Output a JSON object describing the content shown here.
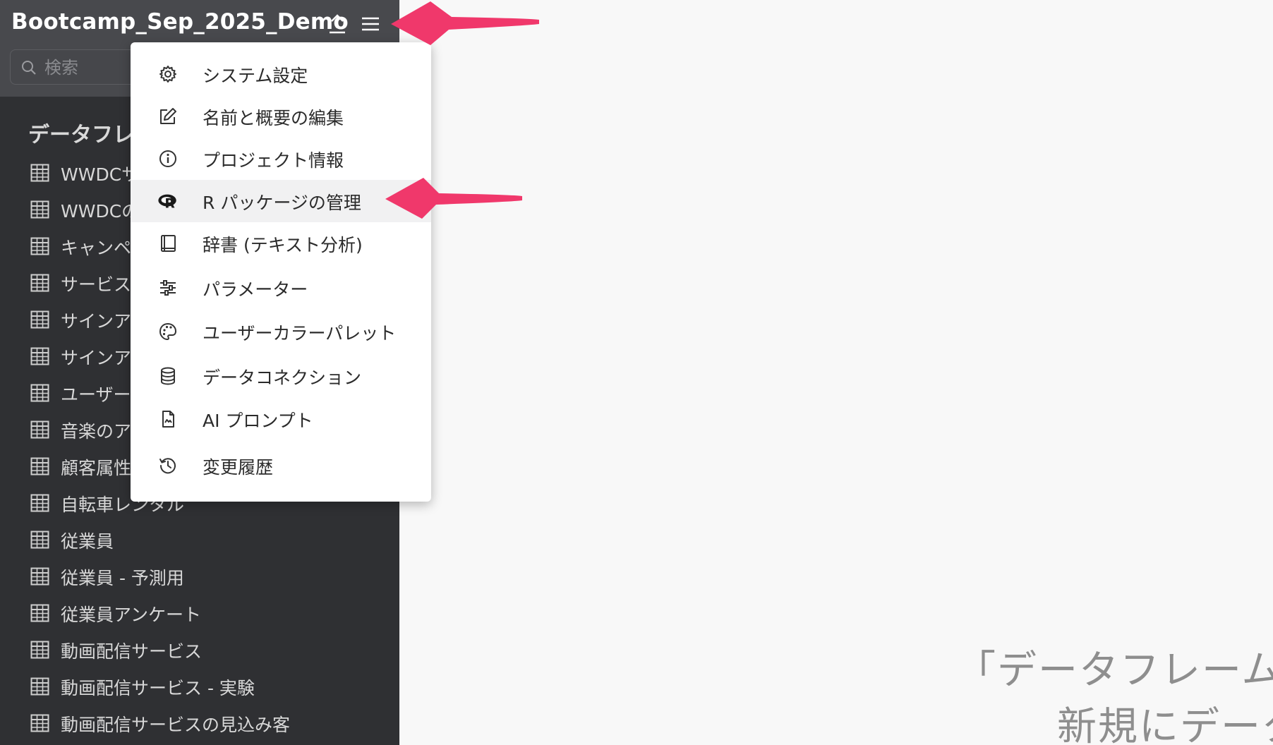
{
  "project": {
    "title": "Bootcamp_Sep_2025_Demo"
  },
  "search": {
    "placeholder": "検索"
  },
  "sidebar": {
    "section_header": "データフレ",
    "items": [
      {
        "label": "WWDCサ"
      },
      {
        "label": "WWDCの"
      },
      {
        "label": "キャンペ"
      },
      {
        "label": "サービス"
      },
      {
        "label": "サインア"
      },
      {
        "label": "サインア"
      },
      {
        "label": "ユーザー"
      },
      {
        "label": "音楽のア"
      },
      {
        "label": "顧客属性"
      },
      {
        "label": "自転車レンタル"
      },
      {
        "label": "従業員"
      },
      {
        "label": "従業員 - 予測用"
      },
      {
        "label": "従業員アンケート"
      },
      {
        "label": "動画配信サービス"
      },
      {
        "label": "動画配信サービス - 実験"
      },
      {
        "label": "動画配信サービスの見込み客"
      }
    ]
  },
  "menu": {
    "items": [
      {
        "label": "システム設定",
        "icon": "gear-icon"
      },
      {
        "label": "名前と概要の編集",
        "icon": "edit-icon"
      },
      {
        "label": "プロジェクト情報",
        "icon": "info-icon"
      },
      {
        "label": "R パッケージの管理",
        "icon": "r-logo-icon",
        "highlighted": true
      },
      {
        "label": "辞書 (テキスト分析)",
        "icon": "book-icon"
      },
      {
        "label": "パラメーター",
        "icon": "sliders-icon"
      },
      {
        "label": "ユーザーカラーパレット",
        "icon": "palette-icon"
      },
      {
        "label": "データコネクション",
        "icon": "database-icon"
      },
      {
        "label": "AI プロンプト",
        "icon": "document-icon"
      },
      {
        "label": "変更履歴",
        "icon": "history-icon"
      }
    ]
  },
  "main": {
    "empty_line1": "「データフレーム」",
    "empty_line2": "新規にデータ"
  },
  "colors": {
    "sidebar_bg": "#2f3033",
    "header_bg": "#48494d",
    "arrow": "#f0386b"
  }
}
